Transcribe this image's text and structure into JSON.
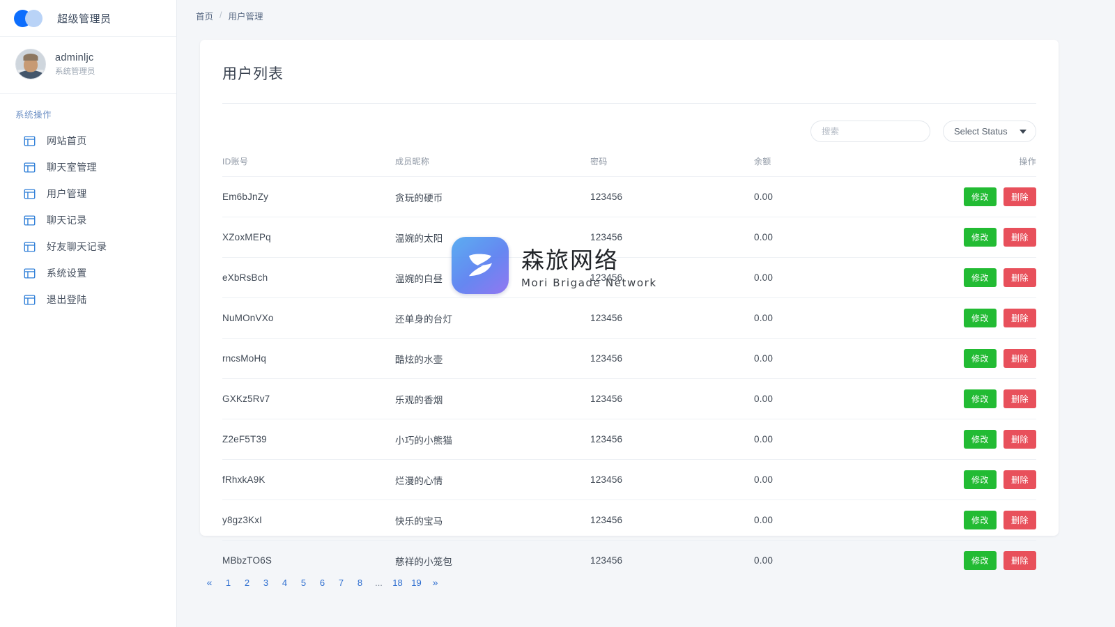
{
  "sidebar": {
    "brand": {
      "title": "超级管理员",
      "logo_icon": "two-circles-logo",
      "color_primary": "#0d6efd",
      "color_secondary": "#b9d3f7"
    },
    "profile": {
      "name": "adminljc",
      "role": "系统管理员",
      "avatar_icon": "user-photo-avatar"
    },
    "section_label": "系统操作",
    "items": [
      {
        "label": "网站首页",
        "icon": "layout-grid-icon"
      },
      {
        "label": "聊天室管理",
        "icon": "layout-grid-icon"
      },
      {
        "label": "用户管理",
        "icon": "layout-grid-icon"
      },
      {
        "label": "聊天记录",
        "icon": "layout-grid-icon"
      },
      {
        "label": "好友聊天记录",
        "icon": "layout-grid-icon"
      },
      {
        "label": "系统设置",
        "icon": "layout-grid-icon"
      },
      {
        "label": "退出登陆",
        "icon": "layout-grid-icon"
      }
    ]
  },
  "breadcrumb": {
    "home": "首页",
    "separator": "/",
    "current": "用户管理"
  },
  "page": {
    "title": "用户列表"
  },
  "toolbar": {
    "search": {
      "value": "",
      "placeholder": "搜索"
    },
    "status_select": {
      "selected": "Select Status",
      "caret_icon": "chevron-down-icon"
    }
  },
  "table": {
    "columns": [
      "ID账号",
      "成员昵称",
      "密码",
      "余额",
      "操作"
    ],
    "rows": [
      {
        "id": "Em6bJnZy",
        "nickname": "贪玩的硬币",
        "password": "123456",
        "balance": "0.00"
      },
      {
        "id": "XZoxMEPq",
        "nickname": "温婉的太阳",
        "password": "123456",
        "balance": "0.00"
      },
      {
        "id": "eXbRsBch",
        "nickname": "温婉的白昼",
        "password": "123456",
        "balance": "0.00"
      },
      {
        "id": "NuMOnVXo",
        "nickname": "还单身的台灯",
        "password": "123456",
        "balance": "0.00"
      },
      {
        "id": "rncsMoHq",
        "nickname": "酷炫的水壶",
        "password": "123456",
        "balance": "0.00"
      },
      {
        "id": "GXKz5Rv7",
        "nickname": "乐观的香烟",
        "password": "123456",
        "balance": "0.00"
      },
      {
        "id": "Z2eF5T39",
        "nickname": "小巧的小熊猫",
        "password": "123456",
        "balance": "0.00"
      },
      {
        "id": "fRhxkA9K",
        "nickname": "烂漫的心情",
        "password": "123456",
        "balance": "0.00"
      },
      {
        "id": "y8gz3KxI",
        "nickname": "快乐的宝马",
        "password": "123456",
        "balance": "0.00"
      },
      {
        "id": "MBbzTO6S",
        "nickname": "慈祥的小笼包",
        "password": "123456",
        "balance": "0.00"
      }
    ],
    "actions": {
      "edit_label": "修改",
      "delete_label": "删除",
      "edit_color": "#22bb33",
      "delete_color": "#e8505b"
    }
  },
  "pagination": {
    "prev": "«",
    "next": "»",
    "dots": "...",
    "pages": [
      "1",
      "2",
      "3",
      "4",
      "5",
      "6",
      "7",
      "8"
    ],
    "tail_pages": [
      "18",
      "19"
    ],
    "link_color": "#2f6fd0"
  },
  "watermark": {
    "name_cn": "森旅网络",
    "name_en": "Mori Brigade Network",
    "logo_icon": "mori-z-logo"
  }
}
